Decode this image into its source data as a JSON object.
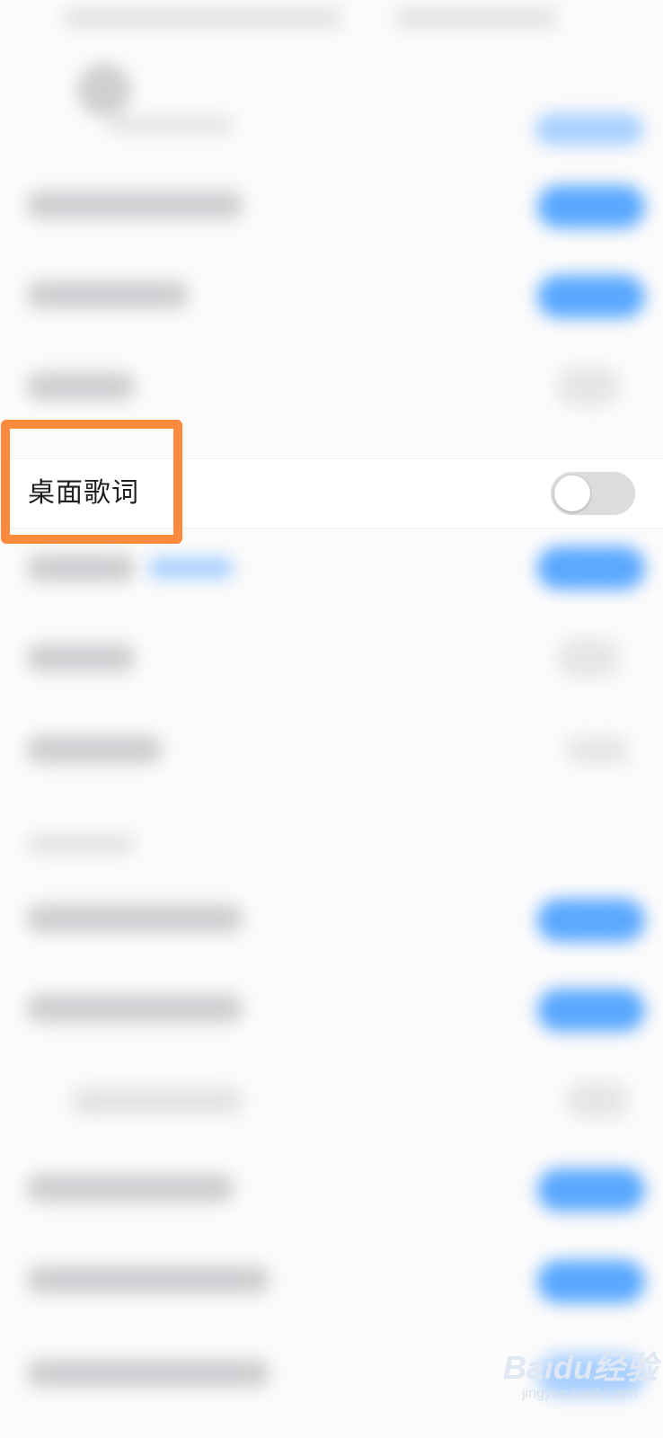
{
  "setting": {
    "label": "桌面歌词",
    "enabled": false
  },
  "colors": {
    "highlight_border": "#ff8a3d",
    "toggle_off": "#dcdcdc",
    "toggle_on": "#5aa8ff"
  },
  "watermark": {
    "brand": "Baidu经验",
    "site": "jingyan.baidu.com"
  },
  "icons": {
    "toggle": "switch-off"
  }
}
